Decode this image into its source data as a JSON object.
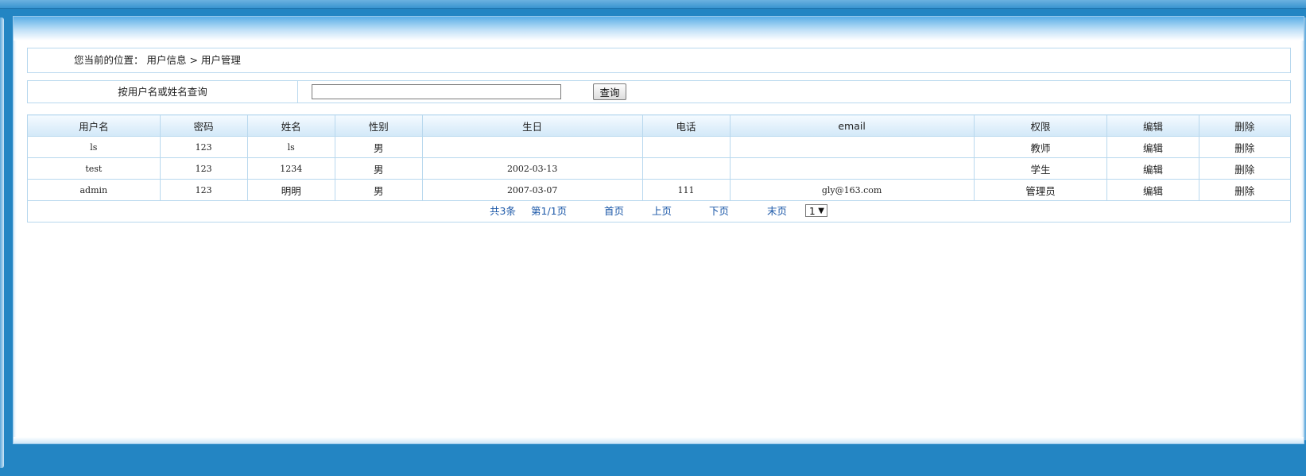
{
  "breadcrumb": {
    "prefix": "您当前的位置：",
    "path": "用户信息 > 用户管理"
  },
  "search": {
    "label": "按用户名或姓名查询",
    "input_value": "",
    "button_label": "查询"
  },
  "table": {
    "headers": [
      "用户名",
      "密码",
      "姓名",
      "性别",
      "生日",
      "电话",
      "email",
      "权限",
      "编辑",
      "删除"
    ],
    "rows": [
      [
        "ls",
        "123",
        "ls",
        "男",
        "",
        "",
        "",
        "教师",
        "编辑",
        "删除"
      ],
      [
        "test",
        "123",
        "1234",
        "男",
        "2002-03-13",
        "",
        "",
        "学生",
        "编辑",
        "删除"
      ],
      [
        "admin",
        "123",
        "明明",
        "男",
        "2007-03-07",
        "111",
        "gly@163.com",
        "管理员",
        "编辑",
        "删除"
      ]
    ]
  },
  "pager": {
    "total": "共3条",
    "page": "第1/1页",
    "first": "首页",
    "prev": "上页",
    "next": "下页",
    "last": "末页",
    "select_value": "1",
    "arrow_icon": "triangle-down-icon"
  }
}
